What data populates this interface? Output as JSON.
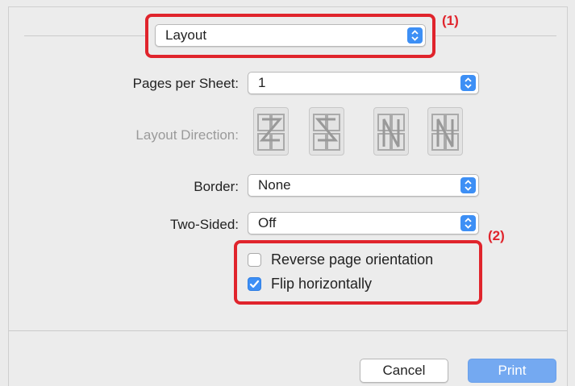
{
  "header": {
    "menu_value": "Layout",
    "callout": "(1)"
  },
  "fields": {
    "pages_per_sheet": {
      "label": "Pages per Sheet:",
      "value": "1"
    },
    "layout_direction": {
      "label": "Layout Direction:",
      "icons": [
        "z-order-icon",
        "reverse-s-order-icon",
        "n-reverse-order-icon",
        "n-order-icon"
      ]
    },
    "border": {
      "label": "Border:",
      "value": "None"
    },
    "two_sided": {
      "label": "Two-Sided:",
      "value": "Off"
    }
  },
  "options": {
    "callout": "(2)",
    "reverse_orientation": {
      "label": "Reverse page orientation",
      "checked": false
    },
    "flip_horizontally": {
      "label": "Flip horizontally",
      "checked": true
    }
  },
  "footer": {
    "cancel": "Cancel",
    "print": "Print"
  },
  "colors": {
    "accent": "#3d8ff5",
    "highlight": "#e0242c",
    "print_button": "#74a9f1"
  }
}
